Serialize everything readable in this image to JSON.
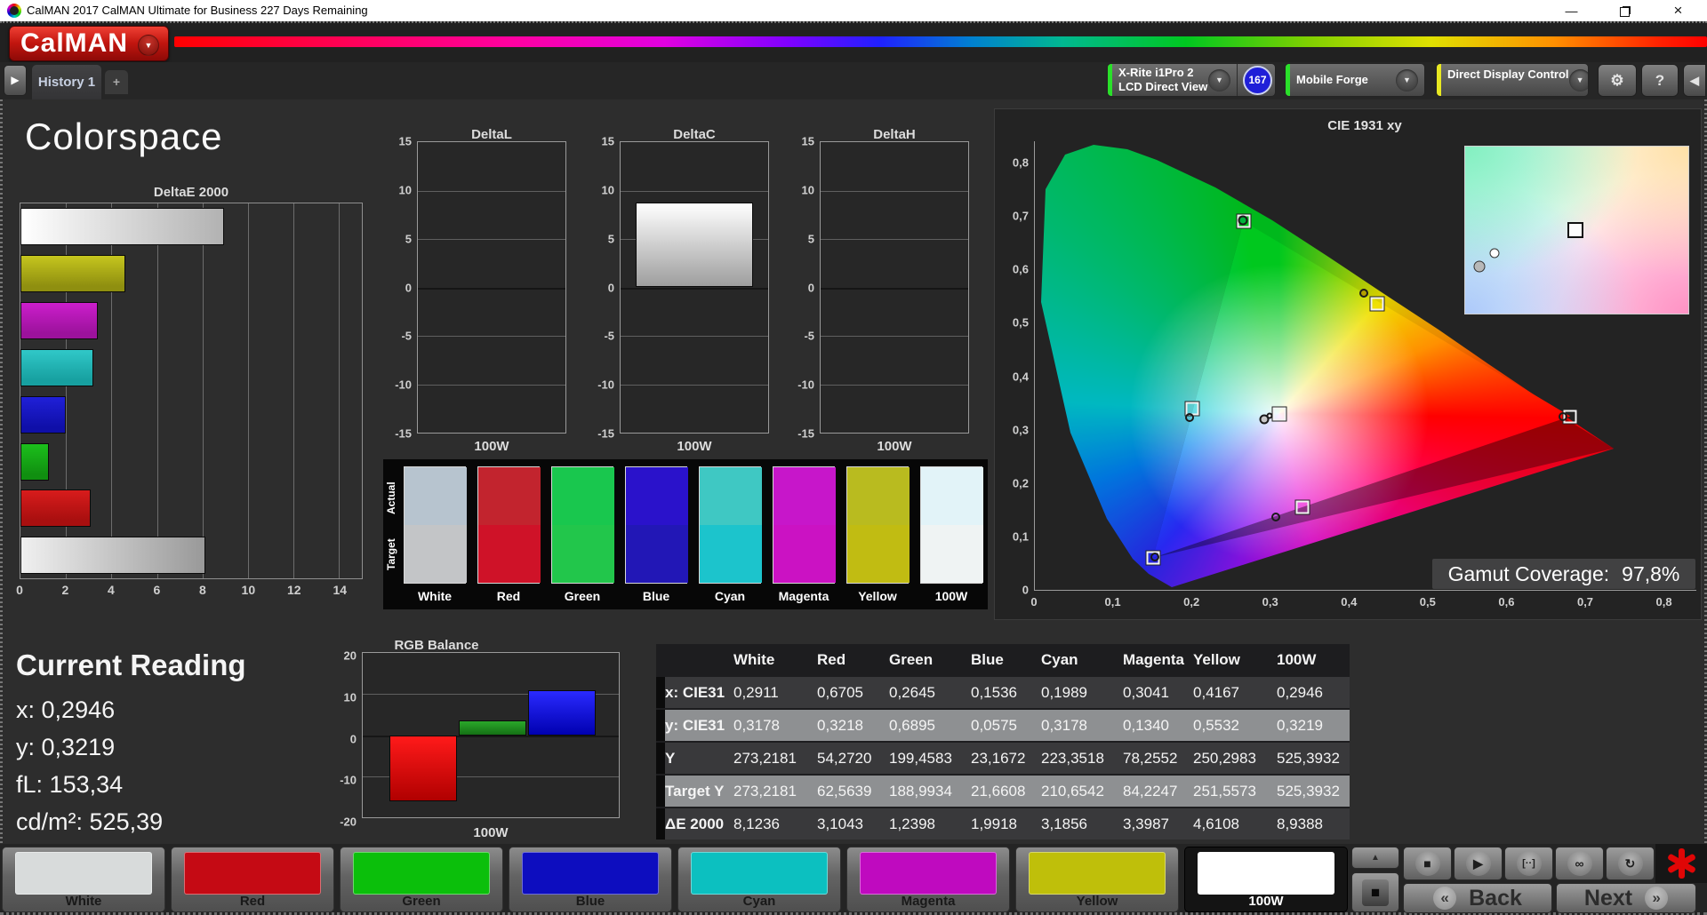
{
  "window": {
    "title": "CalMAN 2017 CalMAN Ultimate for Business 227 Days Remaining",
    "minimize": "—",
    "close": "×"
  },
  "header": {
    "logo_text": "CalMAN"
  },
  "tabbar": {
    "history_tab": "History 1",
    "add_tab": "+",
    "meters": [
      {
        "line1": "X-Rite i1Pro 2",
        "line2": "LCD Direct View",
        "badge": "167",
        "stripe": "#2ae02a"
      },
      {
        "line1": "Mobile Forge",
        "stripe": "#2ae02a"
      },
      {
        "line1": "Direct Display Control",
        "stripe": "#e8e822"
      }
    ]
  },
  "icons": {
    "nav_forward": "▶",
    "dropdown": "▼",
    "gear": "⚙",
    "help": "?",
    "collapse": "◀",
    "chevron_up": "▲",
    "stop": "■",
    "play": "▶",
    "range": "[··]",
    "loop": "∞",
    "refresh": "↻",
    "back_chev": "«",
    "next_chev": "»",
    "pattern_square": "■"
  },
  "page": {
    "title": "Colorspace"
  },
  "chart_data": [
    {
      "type": "bar",
      "title": "DeltaE 2000",
      "orientation": "horizontal",
      "xlim": [
        0,
        15
      ],
      "xticks": [
        0,
        2,
        4,
        6,
        8,
        10,
        12,
        14
      ],
      "grid": true,
      "categories": [
        "100W",
        "Yellow",
        "Magenta",
        "Cyan",
        "Blue",
        "Green",
        "Red",
        "White"
      ],
      "values": [
        8.9388,
        4.6108,
        3.3987,
        3.1856,
        1.9918,
        1.2398,
        3.1043,
        8.1236
      ],
      "colors": [
        {
          "c1": "#ffffff",
          "c2": "#b2b2b2",
          "grad": "h"
        },
        {
          "c1": "#c6c61e",
          "c2": "#8f8f10",
          "grad": "v"
        },
        {
          "c1": "#cc1ecc",
          "c2": "#9c129c",
          "grad": "v"
        },
        {
          "c1": "#30c8c8",
          "c2": "#17a0a0",
          "grad": "v"
        },
        {
          "c1": "#2020d8",
          "c2": "#0f0fa8",
          "grad": "v"
        },
        {
          "c1": "#1cc01c",
          "c2": "#108f10",
          "grad": "v"
        },
        {
          "c1": "#d81c1c",
          "c2": "#a80f0f",
          "grad": "v"
        },
        {
          "c1": "#f0f0f0",
          "c2": "#999999",
          "grad": "h"
        }
      ]
    },
    {
      "type": "bar",
      "group_title": "DeltaLCH",
      "ylim": [
        -15,
        15
      ],
      "yticks": [
        15,
        10,
        5,
        0,
        -5,
        -10,
        -15
      ],
      "xlabel": "100W",
      "charts": [
        {
          "title": "DeltaL",
          "value": 0
        },
        {
          "title": "DeltaC",
          "value": 8.8
        },
        {
          "title": "DeltaH",
          "value": 0
        }
      ]
    },
    {
      "type": "bar",
      "title": "RGB Balance",
      "ylim": [
        -20,
        20
      ],
      "yticks": [
        20,
        10,
        0,
        -10,
        -20
      ],
      "xlabel": "100W",
      "series": [
        {
          "name": "Red",
          "value": -16.0,
          "c1": "#ff1a1a",
          "c2": "#b00000"
        },
        {
          "name": "Green",
          "value": 3.5,
          "c1": "#2aa82a",
          "c2": "#157015"
        },
        {
          "name": "Blue",
          "value": 11.0,
          "c1": "#2a2aff",
          "c2": "#0000b0"
        }
      ]
    },
    {
      "type": "scatter",
      "title": "CIE 1931 xy",
      "xlim": [
        0,
        0.84
      ],
      "ylim": [
        0,
        0.84
      ],
      "xticks": [
        0,
        0.1,
        0.2,
        0.3,
        0.4,
        0.5,
        0.6,
        0.7,
        0.8
      ],
      "yticks": [
        0,
        0.1,
        0.2,
        0.3,
        0.4,
        0.5,
        0.6,
        0.7,
        0.8
      ],
      "coverage_label": "Gamut Coverage:",
      "coverage_value": "97,8%",
      "targets": [
        {
          "name": "white",
          "x": 0.31,
          "y": 0.33
        },
        {
          "name": "red",
          "x": 0.68,
          "y": 0.325
        },
        {
          "name": "green",
          "x": 0.265,
          "y": 0.69
        },
        {
          "name": "blue",
          "x": 0.15,
          "y": 0.06
        },
        {
          "name": "cyan",
          "x": 0.2,
          "y": 0.34
        },
        {
          "name": "magenta",
          "x": 0.34,
          "y": 0.155
        },
        {
          "name": "yellow",
          "x": 0.435,
          "y": 0.535
        }
      ],
      "measured": [
        {
          "name": "white-a",
          "x": 0.291,
          "y": 0.32,
          "fill": "#c8c8c8",
          "r": 11
        },
        {
          "name": "white-b",
          "x": 0.298,
          "y": 0.326,
          "fill": "#ffffff",
          "r": 7
        },
        {
          "name": "red",
          "x": 0.671,
          "y": 0.325,
          "fill": "none",
          "r": 10
        },
        {
          "name": "green",
          "x": 0.264,
          "y": 0.692,
          "fill": "#00b43c",
          "r": 11
        },
        {
          "name": "blue",
          "x": 0.152,
          "y": 0.061,
          "fill": "none",
          "r": 10
        },
        {
          "name": "cyan",
          "x": 0.197,
          "y": 0.322,
          "fill": "none",
          "r": 10
        },
        {
          "name": "magenta",
          "x": 0.306,
          "y": 0.137,
          "fill": "none",
          "r": 10
        },
        {
          "name": "yellow",
          "x": 0.418,
          "y": 0.556,
          "fill": "#b4a000",
          "r": 10
        }
      ],
      "inset": {
        "square": {
          "x": 49.4,
          "y": 50
        },
        "circles": [
          {
            "x": 13.2,
            "y": 63.8,
            "fill": "#ffffff",
            "r": 11
          },
          {
            "x": 6.5,
            "y": 72,
            "fill": "#b8b8b8",
            "r": 13
          }
        ]
      }
    }
  ],
  "swatch_panel": {
    "row_labels": [
      "Actual",
      "Target"
    ],
    "columns": [
      {
        "name": "White",
        "actual": "#b7c4cf",
        "target": "#c3c5c7"
      },
      {
        "name": "Red",
        "actual": "#c2242e",
        "target": "#cf1228"
      },
      {
        "name": "Green",
        "actual": "#19c74e",
        "target": "#22c64b"
      },
      {
        "name": "Blue",
        "actual": "#2a12cb",
        "target": "#2217b6"
      },
      {
        "name": "Cyan",
        "actual": "#3fc8c3",
        "target": "#1cc4cc"
      },
      {
        "name": "Magenta",
        "actual": "#c716ca",
        "target": "#cb12c3"
      },
      {
        "name": "Yellow",
        "actual": "#b9bb1f",
        "target": "#c1bc12"
      },
      {
        "name": "100W",
        "actual": "#e2f3f8",
        "target": "#eff3f3"
      }
    ]
  },
  "current_reading": {
    "title": "Current Reading",
    "lines": [
      {
        "label": "x:",
        "value": "0,2946"
      },
      {
        "label": "y:",
        "value": "0,3219"
      },
      {
        "label": "fL:",
        "value": "153,34"
      },
      {
        "label": "cd/m²:",
        "value": "525,39"
      }
    ]
  },
  "table": {
    "columns": [
      "White",
      "Red",
      "Green",
      "Blue",
      "Cyan",
      "Magenta",
      "Yellow",
      "100W"
    ],
    "rows": [
      {
        "label": "x: CIE31",
        "light": false,
        "values": [
          "0,2911",
          "0,6705",
          "0,2645",
          "0,1536",
          "0,1989",
          "0,3041",
          "0,4167",
          "0,2946"
        ]
      },
      {
        "label": "y: CIE31",
        "light": true,
        "values": [
          "0,3178",
          "0,3218",
          "0,6895",
          "0,0575",
          "0,3178",
          "0,1340",
          "0,5532",
          "0,3219"
        ]
      },
      {
        "label": "Y",
        "light": false,
        "values": [
          "273,2181",
          "54,2720",
          "199,4583",
          "23,1672",
          "223,3518",
          "78,2552",
          "250,2983",
          "525,3932"
        ]
      },
      {
        "label": "Target Y",
        "light": true,
        "values": [
          "273,2181",
          "62,5639",
          "188,9934",
          "21,6608",
          "210,6542",
          "84,2247",
          "251,5573",
          "525,3932"
        ]
      },
      {
        "label": "ΔE 2000",
        "light": false,
        "values": [
          "8,1236",
          "3,1043",
          "1,2398",
          "1,9918",
          "3,1856",
          "3,3987",
          "4,6108",
          "8,9388"
        ]
      }
    ]
  },
  "bottom_bar": {
    "patches": [
      {
        "label": "White",
        "color": "#d8dbdb",
        "selected": false
      },
      {
        "label": "Red",
        "color": "#c50a14",
        "selected": false
      },
      {
        "label": "Green",
        "color": "#0bbf0b",
        "selected": false
      },
      {
        "label": "Blue",
        "color": "#0d0dbf",
        "selected": false
      },
      {
        "label": "Cyan",
        "color": "#0cc0c0",
        "selected": false
      },
      {
        "label": "Magenta",
        "color": "#bf0abf",
        "selected": false
      },
      {
        "label": "Yellow",
        "color": "#bfbf0a",
        "selected": false
      },
      {
        "label": "100W",
        "color": "#ffffff",
        "selected": true
      }
    ],
    "transport": [
      "stop",
      "play",
      "range",
      "loop",
      "refresh"
    ],
    "back_label": "Back",
    "next_label": "Next"
  }
}
